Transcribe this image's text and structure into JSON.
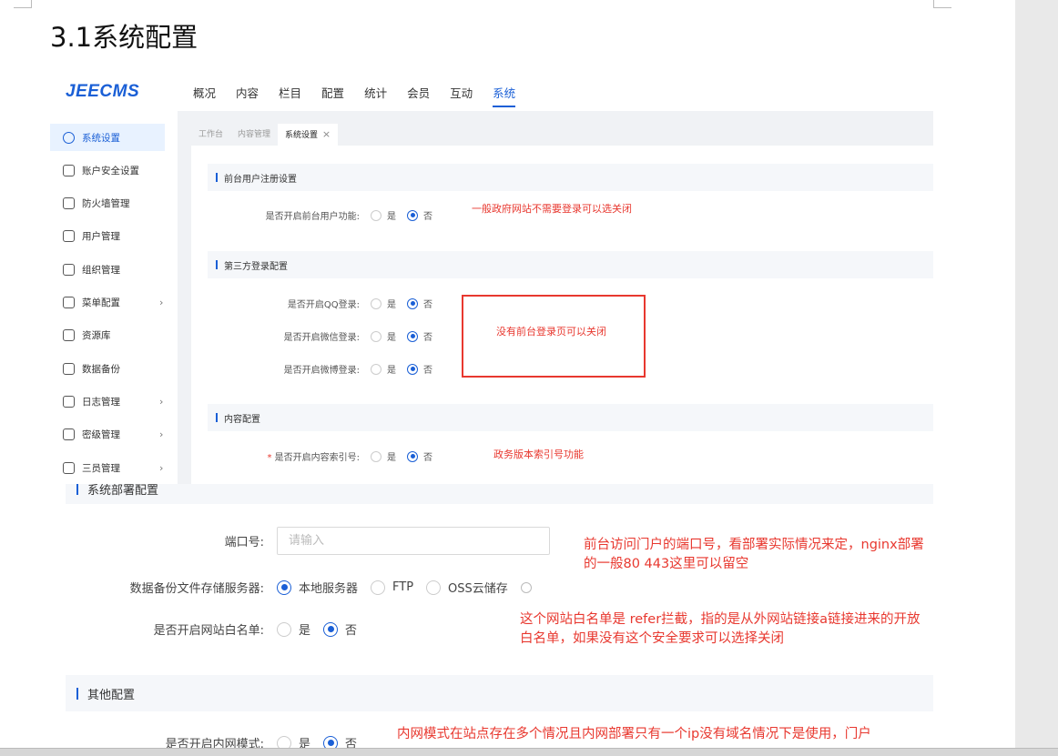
{
  "doc_title": "3.1系统配置",
  "app": {
    "logo": "JEECMS",
    "nav": [
      "概况",
      "内容",
      "栏目",
      "配置",
      "统计",
      "会员",
      "互动",
      "系统"
    ],
    "active_nav": "系统",
    "sidebar": [
      {
        "label": "系统设置",
        "icon": "gear-icon",
        "active": true,
        "chevron": false
      },
      {
        "label": "账户安全设置",
        "icon": "shield-user-icon",
        "chevron": false
      },
      {
        "label": "防火墙管理",
        "icon": "firewall-icon",
        "chevron": false
      },
      {
        "label": "用户管理",
        "icon": "user-icon",
        "chevron": false
      },
      {
        "label": "组织管理",
        "icon": "org-icon",
        "chevron": false
      },
      {
        "label": "菜单配置",
        "icon": "menu-icon",
        "chevron": true
      },
      {
        "label": "资源库",
        "icon": "folder-icon",
        "chevron": false
      },
      {
        "label": "数据备份",
        "icon": "database-icon",
        "chevron": false
      },
      {
        "label": "日志管理",
        "icon": "log-icon",
        "chevron": true
      },
      {
        "label": "密级管理",
        "icon": "lock-icon",
        "chevron": true
      },
      {
        "label": "三员管理",
        "icon": "users-icon",
        "chevron": true
      }
    ],
    "tabs": [
      "工作台",
      "内容管理",
      "系统设置"
    ],
    "tab_close": "×",
    "sections": {
      "register": "前台用户注册设置",
      "third_party": "第三方登录配置",
      "content": "内容配置"
    },
    "rows": {
      "frontend_user": "是否开启前台用户功能:",
      "qq": "是否开启QQ登录:",
      "wechat": "是否开启微信登录:",
      "weibo": "是否开启微博登录:",
      "index_no": "是否开启内容索引号:"
    },
    "required_mark": "*",
    "yes": "是",
    "no": "否"
  },
  "notes": {
    "frontend_user": "一般政府网站不需要登录可以选关闭",
    "third_party": "没有前台登录页可以关闭",
    "index_no": "政务版本索引号功能",
    "port": "前台访问门户的端口号，看部署实际情况来定，nginx部署的一般80 443这里可以留空",
    "whitelist": "这个网站白名单是 refer拦截，指的是从外网站链接a链接进来的开放白名单，如果没有这个安全要求可以选择关闭",
    "intranet": "内网模式在站点存在多个情况且内网部署只有一个ip没有域名情况下是使用，门户"
  },
  "deploy": {
    "section": "系统部署配置",
    "port_label": "端口号:",
    "port_placeholder": "请输入",
    "backup_label": "数据备份文件存储服务器:",
    "backup_options": [
      "本地服务器",
      "FTP",
      "OSS云储存"
    ],
    "whitelist_label": "是否开启网站白名单:",
    "other_section": "其他配置",
    "intranet_label": "是否开启内网模式:"
  }
}
